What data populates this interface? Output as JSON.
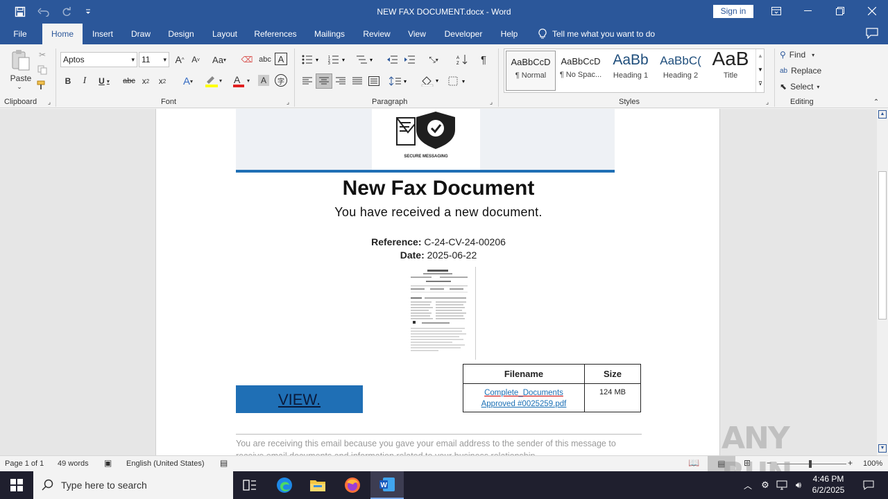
{
  "window": {
    "title": "NEW FAX DOCUMENT.docx  -  Word",
    "sign_in": "Sign in"
  },
  "menu": {
    "tabs": [
      {
        "label": "File"
      },
      {
        "label": "Home"
      },
      {
        "label": "Insert"
      },
      {
        "label": "Draw"
      },
      {
        "label": "Design"
      },
      {
        "label": "Layout"
      },
      {
        "label": "References"
      },
      {
        "label": "Mailings"
      },
      {
        "label": "Review"
      },
      {
        "label": "View"
      },
      {
        "label": "Developer"
      },
      {
        "label": "Help"
      }
    ],
    "active_tab": "Home",
    "tell_me": "Tell me what you want to do"
  },
  "ribbon": {
    "clipboard": {
      "label": "Clipboard",
      "paste": "Paste"
    },
    "font": {
      "label": "Font",
      "family": "Aptos",
      "size": "11"
    },
    "paragraph": {
      "label": "Paragraph"
    },
    "styles": {
      "label": "Styles",
      "items": [
        {
          "preview": "AaBbCcD",
          "name": "¶ Normal"
        },
        {
          "preview": "AaBbCcD",
          "name": "¶ No Spac..."
        },
        {
          "preview": "AaBb",
          "name": "Heading 1"
        },
        {
          "preview": "AaBbC(",
          "name": "Heading 2"
        },
        {
          "preview": "AaB",
          "name": "Title"
        }
      ]
    },
    "editing": {
      "label": "Editing",
      "find": "Find",
      "replace": "Replace",
      "select": "Select"
    }
  },
  "document": {
    "logo_caption": "SECURE MESSAGING",
    "heading": "New Fax Document",
    "subheading": "You have received a new document.",
    "reference_label": "Reference:",
    "reference_value": "C-24-CV-24-00206",
    "date_label": "Date:",
    "date_value": "2025-06-22",
    "view_button": "VIEW.",
    "table": {
      "headers": [
        "Filename",
        "Size"
      ],
      "rows": [
        {
          "filename_line1": "Complete_Documents",
          "filename_line2": "Approved #0025259.pdf",
          "size": "124 MB"
        }
      ]
    },
    "footer_line1": "You are receiving this email because you gave your email address to the sender of this message to",
    "footer_line2": "receive email documents and information related to your business relationship."
  },
  "status": {
    "page": "Page 1 of 1",
    "words": "49 words",
    "language": "English (United States)",
    "zoom": "100%"
  },
  "taskbar": {
    "search_placeholder": "Type here to search",
    "time": "4:46 PM",
    "date": "6/2/2025"
  },
  "watermark": "ANY RUN",
  "colors": {
    "accent": "#2b579a",
    "banner_blue": "#1f6fb5",
    "link": "#1a6fb5"
  }
}
